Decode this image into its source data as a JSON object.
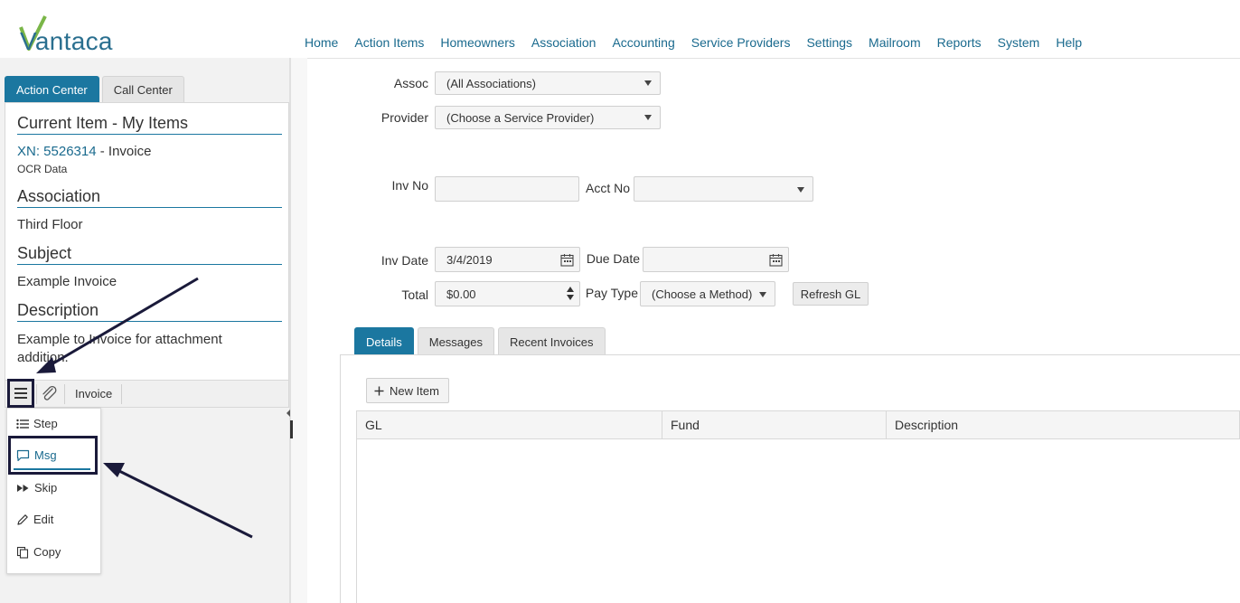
{
  "brand": {
    "name": "Vantaca",
    "logo_color": "#2a6f8f",
    "check_color": "#7ab648"
  },
  "topnav": [
    "Home",
    "Action Items",
    "Homeowners",
    "Association",
    "Accounting",
    "Service Providers",
    "Settings",
    "Mailroom",
    "Reports",
    "System",
    "Help"
  ],
  "left_tabs": {
    "active": "Action Center",
    "inactive": "Call Center"
  },
  "current_item": {
    "heading": "Current Item - My Items",
    "xn_link": "XN: 5526314",
    "item_type": "- Invoice",
    "sub": "OCR Data",
    "association_heading": "Association",
    "association_value": "Third Floor",
    "subject_heading": "Subject",
    "subject_value": "Example Invoice",
    "description_heading": "Description",
    "description_value": "Example to Invoice for attachment addition."
  },
  "toolbar": {
    "menu_icon": "hamburger-icon",
    "attach_icon": "paperclip-icon",
    "invoice_label": "Invoice"
  },
  "action_menu": [
    {
      "label": "Step",
      "icon": "list-icon"
    },
    {
      "label": "Msg",
      "icon": "speech-bubble-icon"
    },
    {
      "label": "Skip",
      "icon": "fast-forward-icon"
    },
    {
      "label": "Edit",
      "icon": "pencil-icon"
    },
    {
      "label": "Copy",
      "icon": "copy-icon"
    }
  ],
  "form": {
    "assoc_label": "Assoc",
    "assoc_value": "(All Associations)",
    "provider_label": "Provider",
    "provider_value": "(Choose a Service Provider)",
    "invno_label": "Inv No",
    "invno_value": "",
    "acctno_label": "Acct No",
    "acctno_value": "",
    "invdate_label": "Inv Date",
    "invdate_value": "3/4/2019",
    "duedate_label": "Due Date",
    "duedate_value": "",
    "total_label": "Total",
    "total_value": "$0.00",
    "paytype_label": "Pay Type",
    "paytype_value": "(Choose a Method)",
    "refresh_label": "Refresh GL"
  },
  "detail_tabs": {
    "active": "Details",
    "others": [
      "Messages",
      "Recent Invoices"
    ]
  },
  "detail": {
    "new_item_label": "New Item",
    "columns": [
      "GL",
      "Fund",
      "Description"
    ]
  },
  "colors": {
    "accent": "#1b77a0",
    "link": "#1a6a8e",
    "annotation": "#1a1a3a"
  }
}
